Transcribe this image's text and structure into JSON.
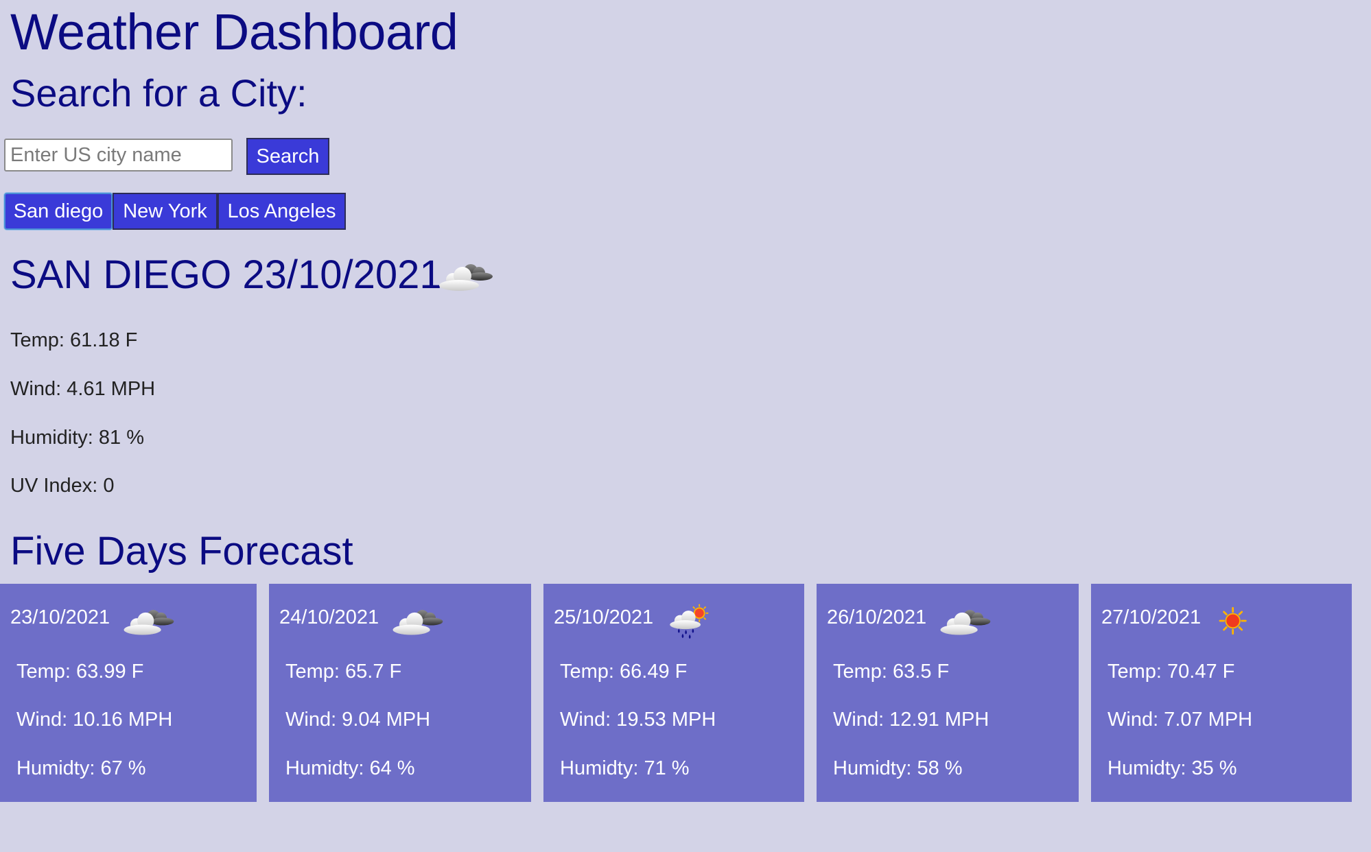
{
  "app": {
    "title": "Weather Dashboard"
  },
  "search": {
    "heading": "Search for a City:",
    "placeholder": "Enter US city name",
    "value": "",
    "button_label": "Search"
  },
  "history": {
    "cities": [
      "San diego",
      "New York",
      "Los Angeles"
    ],
    "active_index": 0
  },
  "current": {
    "title": "SAN DIEGO 23/10/2021",
    "icon": "cloudy-icon",
    "temp": "Temp: 61.18 F",
    "wind": "Wind: 4.61 MPH",
    "humidity": "Humidity: 81 %",
    "uv": "UV Index: 0"
  },
  "forecast": {
    "heading": "Five Days Forecast",
    "days": [
      {
        "date": "23/10/2021",
        "icon": "cloudy-icon",
        "temp": "Temp: 63.99 F",
        "wind": "Wind: 10.16 MPH",
        "humidity": "Humidty: 67 %"
      },
      {
        "date": "24/10/2021",
        "icon": "cloudy-icon",
        "temp": "Temp: 65.7 F",
        "wind": "Wind: 9.04 MPH",
        "humidity": "Humidty: 64 %"
      },
      {
        "date": "25/10/2021",
        "icon": "rain-sun-icon",
        "temp": "Temp: 66.49 F",
        "wind": "Wind: 19.53 MPH",
        "humidity": "Humidty: 71 %"
      },
      {
        "date": "26/10/2021",
        "icon": "cloudy-icon",
        "temp": "Temp: 63.5 F",
        "wind": "Wind: 12.91 MPH",
        "humidity": "Humidty: 58 %"
      },
      {
        "date": "27/10/2021",
        "icon": "sun-icon",
        "temp": "Temp: 70.47 F",
        "wind": "Wind: 7.07 MPH",
        "humidity": "Humidty: 35 %"
      }
    ]
  },
  "colors": {
    "background": "#d3d3e7",
    "heading": "#0b0b82",
    "button": "#3a3ad8",
    "card": "#6e6ec8"
  }
}
